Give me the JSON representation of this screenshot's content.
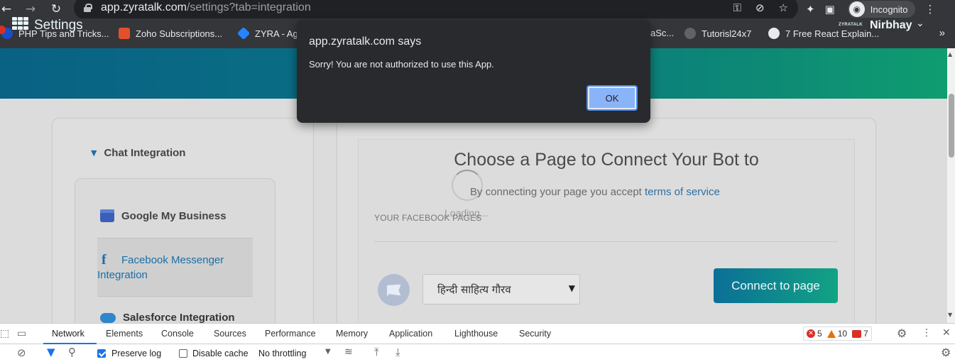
{
  "browser": {
    "url_host": "app.zyratalk.com",
    "url_path": "/settings?tab=integration",
    "incognito_label": "Incognito",
    "bookmarks": [
      {
        "label": "PHP Tips and Tricks...",
        "color": "#1a4ec9"
      },
      {
        "label": "Zoho Subscriptions...",
        "color": "#e2502e"
      },
      {
        "label": "ZYRA - Ag",
        "color": "#2684ff"
      },
      {
        "label": "aSc...",
        "color": "#35363a"
      },
      {
        "label": "Tutorisl24x7",
        "color": "#5f6368"
      },
      {
        "label": "7 Free React Explain...",
        "color": "#e8eaed"
      }
    ],
    "bookmarks_more": "»"
  },
  "header": {
    "title": "Settings",
    "brand_mini": "ZYRATALK",
    "user_name": "Nirbhay",
    "accent_start": "#0b6f97",
    "accent_end": "#12b380"
  },
  "sidebar": {
    "section_label": "Chat Integration",
    "items": [
      {
        "label": "Google My Business",
        "icon": "google-my-business-icon"
      },
      {
        "label": "Facebook Messenger Integration",
        "icon": "facebook-icon",
        "active": true
      },
      {
        "label": "Salesforce Integration",
        "icon": "salesforce-icon"
      }
    ]
  },
  "main": {
    "title": "Choose a Page to Connect Your Bot to",
    "terms_prefix": "By connecting your page you accept",
    "terms_link": "terms of service",
    "loading": "Loading...",
    "pages_header": "YOUR FACEBOOK PAGES",
    "selected_page": "हिन्दी साहित्य गौरव",
    "connect_button": "Connect to page"
  },
  "dialog": {
    "title": "app.zyratalk.com says",
    "message": "Sorry! You are not authorized to use this App.",
    "ok": "OK"
  },
  "devtools": {
    "tabs": [
      "Network",
      "Elements",
      "Console",
      "Sources",
      "Performance",
      "Memory",
      "Application",
      "Lighthouse",
      "Security"
    ],
    "active_tab": "Network",
    "errors": "5",
    "warnings": "10",
    "issues": "7",
    "preserve_log": "Preserve log",
    "disable_cache": "Disable cache",
    "throttling": "No throttling"
  }
}
